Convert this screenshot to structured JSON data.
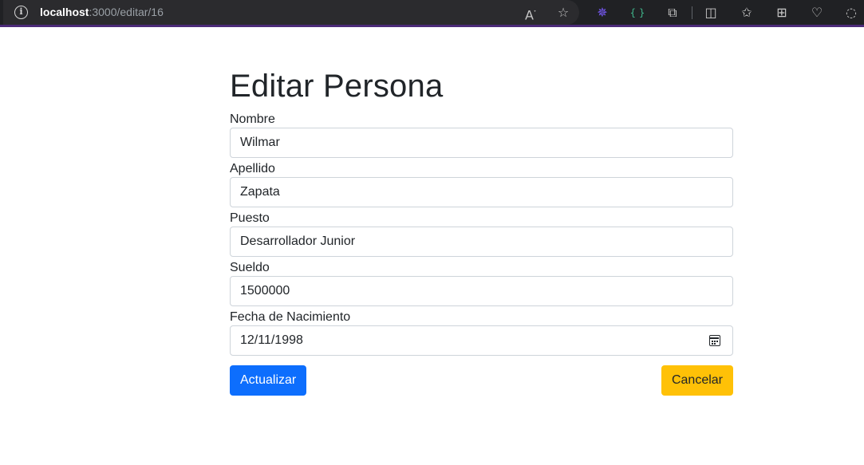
{
  "browser": {
    "url_host": "localhost",
    "url_path": ":3000/editar/16",
    "info_glyph": "i",
    "toolbar_icons": [
      "read-aloud-icon",
      "favorite-star-icon",
      "extension-color-icon",
      "extension-braces-icon",
      "extensions-puzzle-icon",
      "split-screen-icon",
      "favorites-icon",
      "collections-icon",
      "browser-essentials-icon",
      "copilot-icon"
    ]
  },
  "page": {
    "title": "Editar Persona"
  },
  "form": {
    "fields": [
      {
        "label": "Nombre",
        "value": "Wilmar"
      },
      {
        "label": "Apellido",
        "value": "Zapata"
      },
      {
        "label": "Puesto",
        "value": "Desarrollador Junior"
      },
      {
        "label": "Sueldo",
        "value": "1500000"
      },
      {
        "label": "Fecha de Nacimiento",
        "value": "12/11/1998"
      }
    ],
    "update_label": "Actualizar",
    "cancel_label": "Cancelar"
  },
  "colors": {
    "primary": "#0d6efd",
    "warning": "#ffc107",
    "text": "#212529",
    "border": "#ced4da",
    "browser_accent": "#4b2a78"
  }
}
